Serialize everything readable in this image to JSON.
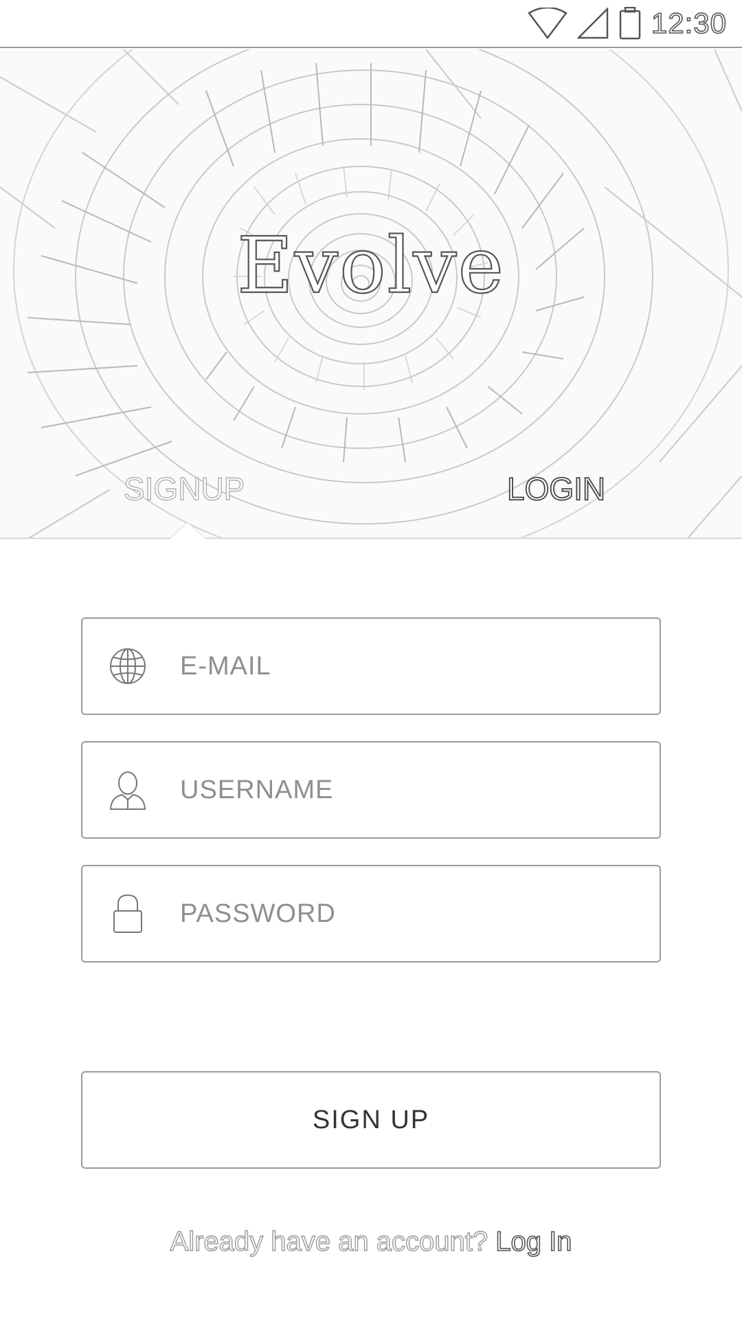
{
  "status_bar": {
    "time": "12:30",
    "icons": [
      "wifi-icon",
      "cellular-signal-icon",
      "battery-icon"
    ]
  },
  "hero": {
    "app_title": "Evolve",
    "background": "spiral-staircase-image",
    "tabs": [
      {
        "label": "SIGNUP",
        "active": true
      },
      {
        "label": "LOGIN",
        "active": false
      }
    ]
  },
  "form": {
    "email": {
      "placeholder": "E-MAIL",
      "value": "",
      "icon": "globe-icon"
    },
    "username": {
      "placeholder": "USERNAME",
      "value": "",
      "icon": "user-icon"
    },
    "password": {
      "placeholder": "PASSWORD",
      "value": "",
      "icon": "lock-icon"
    },
    "submit_label": "SIGN UP"
  },
  "footer": {
    "prompt": "Already have an account?",
    "link_label": "Log In"
  },
  "colors": {
    "background": "#ffffff",
    "border": "#9b9b9b",
    "text": "#333333",
    "placeholder": "#8e8e8e"
  }
}
